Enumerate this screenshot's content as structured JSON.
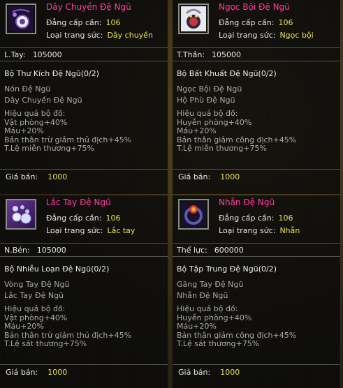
{
  "labels": {
    "level_required": "Đẳng cấp cần:",
    "equipment_type": "Loại trang sức:",
    "set_effect": "Hiệu quả bộ đồ:",
    "price": "Giá bán:"
  },
  "items": [
    {
      "name": "Dây Chuyền Đệ Ngũ",
      "icon": "necklace-icon",
      "level": "106",
      "type": "Dây chuyền",
      "stat_label": "L.Tay:",
      "stat_value": "105000",
      "set_name": "Bộ Thư Kích Đệ Ngũ(0/2)",
      "set_pieces": [
        "Nón Đệ Ngũ",
        "Dây Chuyền Đệ Ngũ"
      ],
      "effects": [
        "Vật phòng+40%",
        "Máu+20%",
        "Bản thân trừ giảm thủ địch+45%",
        "T.Lệ miễn thương+75%"
      ],
      "price": "1000"
    },
    {
      "name": "Ngọc Bội Đệ Ngũ",
      "icon": "jade-pendant-icon",
      "level": "106",
      "type": "Ngọc bội",
      "stat_label": "T.Thần:",
      "stat_value": "105000",
      "set_name": "Bộ Bất Khuất Đệ Ngũ(0/2)",
      "set_pieces": [
        "Ngọc Bội Đệ Ngũ",
        "Hộ Phù Đệ Ngũ"
      ],
      "effects": [
        "Huyễn phòng+40%",
        "Máu+20%",
        "Bản thân giảm công địch+45%",
        "T.Lệ miễn thương+75%"
      ],
      "price": "1000"
    },
    {
      "name": "Lắc Tay Đệ Ngũ",
      "icon": "bracelet-icon",
      "level": "106",
      "type": "Lắc tay",
      "stat_label": "N.Bén:",
      "stat_value": "105000",
      "set_name": "Bộ Nhiễu Loạn Đệ Ngũ(0/2)",
      "set_pieces": [
        "Vòng Tay Đệ Ngũ",
        "Lắc Tay Đệ Ngũ"
      ],
      "effects": [
        "Vật phòng+40%",
        "Máu+20%",
        "Bản thân trừ giảm thủ địch+45%",
        "T.Lệ sát thương+75%"
      ],
      "price": "1000"
    },
    {
      "name": "Nhẫn Đệ Ngũ",
      "icon": "ring-icon",
      "level": "106",
      "type": "Nhẫn",
      "stat_label": "Thể lực:",
      "stat_value": "600000",
      "set_name": "Bộ Tập Trung Đệ Ngũ(0/2)",
      "set_pieces": [
        "Găng Tay Đệ Ngũ",
        "Nhẫn Đệ Ngũ"
      ],
      "effects": [
        "Huyễn phòng+40%",
        "Máu+20%",
        "Bản thân giảm công địch+45%",
        "T.Lệ sát thương+75%"
      ],
      "price": "1000"
    }
  ],
  "colors": {
    "item_name": "#ff3ea0",
    "value_yellow": "#e9e24a",
    "panel_bg": "#0a0a0a"
  }
}
